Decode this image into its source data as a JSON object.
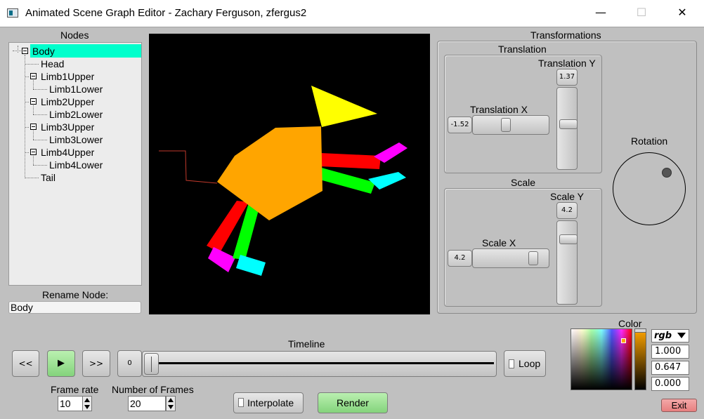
{
  "window": {
    "title": "Animated Scene Graph Editor - Zachary Ferguson, zfergus2",
    "minimize_glyph": "—",
    "maximize_glyph": "☐",
    "close_glyph": "✕"
  },
  "nodes_panel": {
    "title": "Nodes",
    "tree": [
      {
        "label": "Body",
        "selected": true
      },
      {
        "label": "Head"
      },
      {
        "label": "Limb1Upper"
      },
      {
        "label": "Limb1Lower"
      },
      {
        "label": "Limb2Upper"
      },
      {
        "label": "Limb2Lower"
      },
      {
        "label": "Limb3Upper"
      },
      {
        "label": "Limb3Lower"
      },
      {
        "label": "Limb4Upper"
      },
      {
        "label": "Limb4Lower"
      },
      {
        "label": "Tail"
      }
    ],
    "selection_color": "#00ffcc",
    "rename_label": "Rename Node:",
    "rename_value": "Body"
  },
  "scene": {
    "background": "#000000",
    "colors": {
      "body": "#ffa500",
      "head": "#ffff00",
      "tail": "#c0392b",
      "limb_red": "#ff0000",
      "limb_green": "#00ff00",
      "limb_magenta": "#ff00ff",
      "limb_cyan": "#00ffff"
    }
  },
  "transformations": {
    "title": "Transformations",
    "translation": {
      "title": "Translation",
      "x_label": "Translation X",
      "x_value": "-1.52",
      "y_label": "Translation Y",
      "y_value": "1.37"
    },
    "scale": {
      "title": "Scale",
      "x_label": "Scale X",
      "x_value": "4.2",
      "y_label": "Scale Y",
      "y_value": "4.2"
    },
    "rotation_label": "Rotation"
  },
  "color_picker": {
    "title": "Color",
    "mode": "rgb",
    "r": "1.000",
    "g": "0.647",
    "b": "0.000"
  },
  "timeline": {
    "title": "Timeline",
    "rewind_label": "<<",
    "play_glyph": "▶",
    "forward_label": ">>",
    "frame_value": "0",
    "loop_label": "Loop"
  },
  "bottom": {
    "frame_rate_label": "Frame rate",
    "frame_rate_value": "10",
    "num_frames_label": "Number of Frames",
    "num_frames_value": "20",
    "interpolate_label": "Interpolate",
    "render_label": "Render",
    "exit_label": "Exit"
  }
}
